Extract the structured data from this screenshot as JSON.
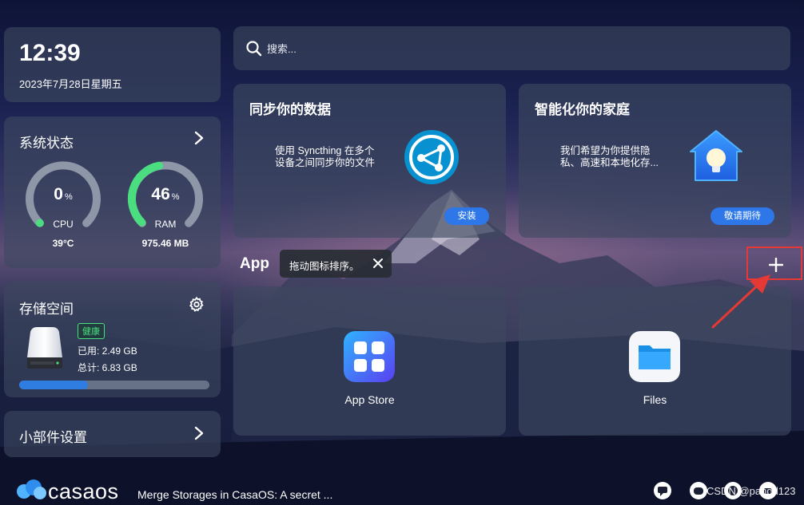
{
  "clock": {
    "time": "12:39",
    "date": "2023年7月28日星期五"
  },
  "system": {
    "title": "系统状态",
    "cpu": {
      "value": "0",
      "unit": "%",
      "label": "CPU",
      "sub": "39°C",
      "percent": 0
    },
    "ram": {
      "value": "46",
      "unit": "%",
      "label": "RAM",
      "sub": "975.46 MB",
      "percent": 46
    }
  },
  "storage": {
    "title": "存储空间",
    "badge": "健康",
    "used": "已用: 2.49 GB",
    "total": "总计: 6.83 GB",
    "fill_fraction": 0.36
  },
  "widget_settings": {
    "label": "小部件设置"
  },
  "search": {
    "placeholder": "搜索..."
  },
  "promos": [
    {
      "title": "同步你的数据",
      "desc_line1": "使用 Syncthing 在多个",
      "desc_line2": "设备之间同步你的文件",
      "button": "安装"
    },
    {
      "title": "智能化你的家庭",
      "desc_line1": "我们希望为你提供隐",
      "desc_line2": "私、高速和本地化存...",
      "button": "敬请期待"
    }
  ],
  "apps": {
    "header": "App",
    "tooltip": "拖动图标排序。",
    "items": [
      {
        "name": "App Store"
      },
      {
        "name": "Files"
      }
    ]
  },
  "footer": {
    "logo": "casaos",
    "news": "Merge Storages in CasaOS: A secret ..."
  },
  "watermark": "CSDN @pandd123",
  "colors": {
    "accent": "#2d77e8",
    "cpu_gauge": "#4ade80",
    "ram_gauge": "#4ade80",
    "highlight": "#e53935"
  }
}
